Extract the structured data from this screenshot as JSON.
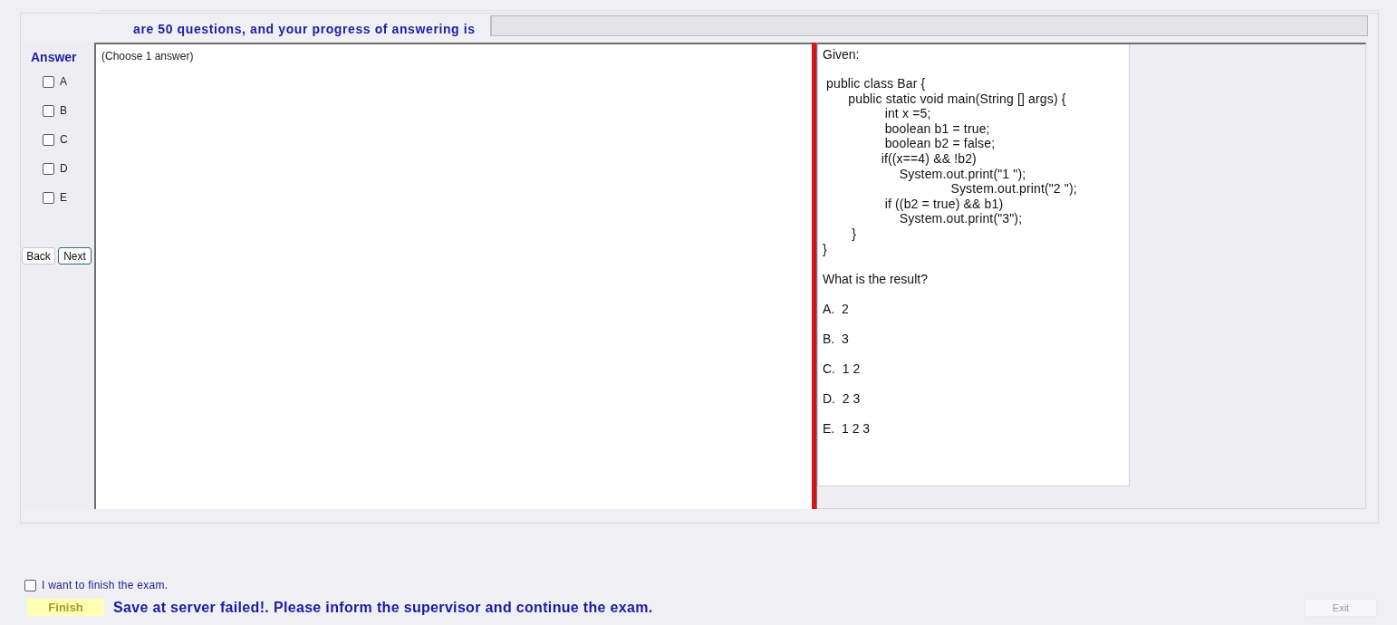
{
  "header": {
    "progress_text": "are 50 questions, and your progress of answering is",
    "progress": {
      "level": 0
    }
  },
  "answer_panel": {
    "title": "Answer",
    "options": [
      {
        "label": "A",
        "checked": false
      },
      {
        "label": "B",
        "checked": false
      },
      {
        "label": "C",
        "checked": false
      },
      {
        "label": "D",
        "checked": false
      },
      {
        "label": "E",
        "checked": false
      }
    ],
    "buttons": [
      {
        "label": "Back",
        "focused": false
      },
      {
        "label": "Next",
        "focused": true
      }
    ]
  },
  "question": {
    "instruction": "(Choose 1 answer)"
  },
  "question_text": {
    "intro": "Given:",
    "code_lines": [
      " public class Bar {",
      "       public static void main(String [] args) {",
      "                 int x =5;",
      "                 boolean b1 = true;",
      "                 boolean b2 = false;",
      "                if((x==4) && !b2)",
      "                     System.out.print(\"1 \");",
      "                                   System.out.print(\"2 \");",
      "                 if ((b2 = true) && b1)",
      "                     System.out.print(\"3\");",
      "        }",
      "}"
    ],
    "prompt": "What is the result?",
    "choices": [
      "A.  2",
      "B.  3",
      "C.  1 2",
      "D.  2 3",
      "E.  1 2 3"
    ]
  },
  "footer": {
    "finish_checkbox": {
      "label": "I want to finish the exam.",
      "checked": false
    },
    "finish_button": {
      "label": "Finish"
    },
    "message": "Save at server failed!. Please inform the supervisor and continue the exam.",
    "exit_button": {
      "label": "Exit",
      "disabled": true
    }
  }
}
